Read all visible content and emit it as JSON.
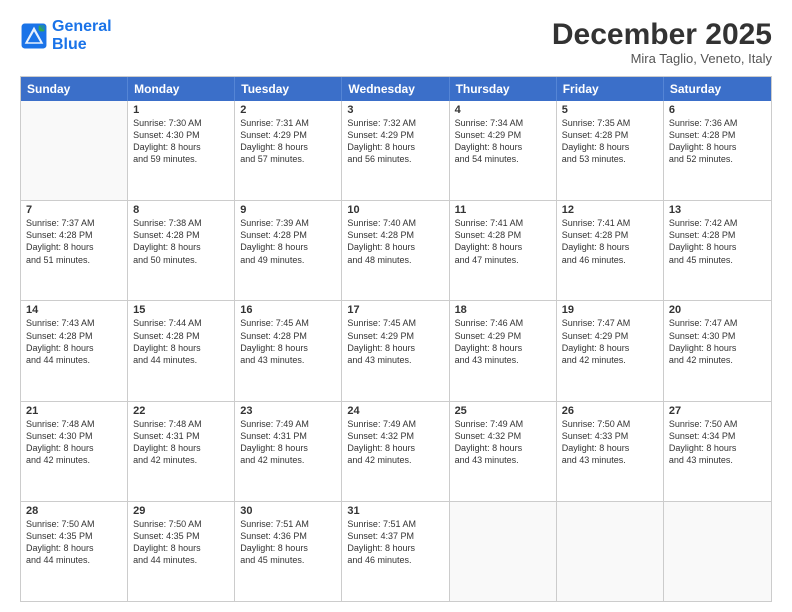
{
  "logo": {
    "line1": "General",
    "line2": "Blue"
  },
  "title": "December 2025",
  "location": "Mira Taglio, Veneto, Italy",
  "header_days": [
    "Sunday",
    "Monday",
    "Tuesday",
    "Wednesday",
    "Thursday",
    "Friday",
    "Saturday"
  ],
  "weeks": [
    [
      {
        "day": "",
        "info": ""
      },
      {
        "day": "1",
        "info": "Sunrise: 7:30 AM\nSunset: 4:30 PM\nDaylight: 8 hours\nand 59 minutes."
      },
      {
        "day": "2",
        "info": "Sunrise: 7:31 AM\nSunset: 4:29 PM\nDaylight: 8 hours\nand 57 minutes."
      },
      {
        "day": "3",
        "info": "Sunrise: 7:32 AM\nSunset: 4:29 PM\nDaylight: 8 hours\nand 56 minutes."
      },
      {
        "day": "4",
        "info": "Sunrise: 7:34 AM\nSunset: 4:29 PM\nDaylight: 8 hours\nand 54 minutes."
      },
      {
        "day": "5",
        "info": "Sunrise: 7:35 AM\nSunset: 4:28 PM\nDaylight: 8 hours\nand 53 minutes."
      },
      {
        "day": "6",
        "info": "Sunrise: 7:36 AM\nSunset: 4:28 PM\nDaylight: 8 hours\nand 52 minutes."
      }
    ],
    [
      {
        "day": "7",
        "info": "Sunrise: 7:37 AM\nSunset: 4:28 PM\nDaylight: 8 hours\nand 51 minutes."
      },
      {
        "day": "8",
        "info": "Sunrise: 7:38 AM\nSunset: 4:28 PM\nDaylight: 8 hours\nand 50 minutes."
      },
      {
        "day": "9",
        "info": "Sunrise: 7:39 AM\nSunset: 4:28 PM\nDaylight: 8 hours\nand 49 minutes."
      },
      {
        "day": "10",
        "info": "Sunrise: 7:40 AM\nSunset: 4:28 PM\nDaylight: 8 hours\nand 48 minutes."
      },
      {
        "day": "11",
        "info": "Sunrise: 7:41 AM\nSunset: 4:28 PM\nDaylight: 8 hours\nand 47 minutes."
      },
      {
        "day": "12",
        "info": "Sunrise: 7:41 AM\nSunset: 4:28 PM\nDaylight: 8 hours\nand 46 minutes."
      },
      {
        "day": "13",
        "info": "Sunrise: 7:42 AM\nSunset: 4:28 PM\nDaylight: 8 hours\nand 45 minutes."
      }
    ],
    [
      {
        "day": "14",
        "info": "Sunrise: 7:43 AM\nSunset: 4:28 PM\nDaylight: 8 hours\nand 44 minutes."
      },
      {
        "day": "15",
        "info": "Sunrise: 7:44 AM\nSunset: 4:28 PM\nDaylight: 8 hours\nand 44 minutes."
      },
      {
        "day": "16",
        "info": "Sunrise: 7:45 AM\nSunset: 4:28 PM\nDaylight: 8 hours\nand 43 minutes."
      },
      {
        "day": "17",
        "info": "Sunrise: 7:45 AM\nSunset: 4:29 PM\nDaylight: 8 hours\nand 43 minutes."
      },
      {
        "day": "18",
        "info": "Sunrise: 7:46 AM\nSunset: 4:29 PM\nDaylight: 8 hours\nand 43 minutes."
      },
      {
        "day": "19",
        "info": "Sunrise: 7:47 AM\nSunset: 4:29 PM\nDaylight: 8 hours\nand 42 minutes."
      },
      {
        "day": "20",
        "info": "Sunrise: 7:47 AM\nSunset: 4:30 PM\nDaylight: 8 hours\nand 42 minutes."
      }
    ],
    [
      {
        "day": "21",
        "info": "Sunrise: 7:48 AM\nSunset: 4:30 PM\nDaylight: 8 hours\nand 42 minutes."
      },
      {
        "day": "22",
        "info": "Sunrise: 7:48 AM\nSunset: 4:31 PM\nDaylight: 8 hours\nand 42 minutes."
      },
      {
        "day": "23",
        "info": "Sunrise: 7:49 AM\nSunset: 4:31 PM\nDaylight: 8 hours\nand 42 minutes."
      },
      {
        "day": "24",
        "info": "Sunrise: 7:49 AM\nSunset: 4:32 PM\nDaylight: 8 hours\nand 42 minutes."
      },
      {
        "day": "25",
        "info": "Sunrise: 7:49 AM\nSunset: 4:32 PM\nDaylight: 8 hours\nand 43 minutes."
      },
      {
        "day": "26",
        "info": "Sunrise: 7:50 AM\nSunset: 4:33 PM\nDaylight: 8 hours\nand 43 minutes."
      },
      {
        "day": "27",
        "info": "Sunrise: 7:50 AM\nSunset: 4:34 PM\nDaylight: 8 hours\nand 43 minutes."
      }
    ],
    [
      {
        "day": "28",
        "info": "Sunrise: 7:50 AM\nSunset: 4:35 PM\nDaylight: 8 hours\nand 44 minutes."
      },
      {
        "day": "29",
        "info": "Sunrise: 7:50 AM\nSunset: 4:35 PM\nDaylight: 8 hours\nand 44 minutes."
      },
      {
        "day": "30",
        "info": "Sunrise: 7:51 AM\nSunset: 4:36 PM\nDaylight: 8 hours\nand 45 minutes."
      },
      {
        "day": "31",
        "info": "Sunrise: 7:51 AM\nSunset: 4:37 PM\nDaylight: 8 hours\nand 46 minutes."
      },
      {
        "day": "",
        "info": ""
      },
      {
        "day": "",
        "info": ""
      },
      {
        "day": "",
        "info": ""
      }
    ]
  ]
}
